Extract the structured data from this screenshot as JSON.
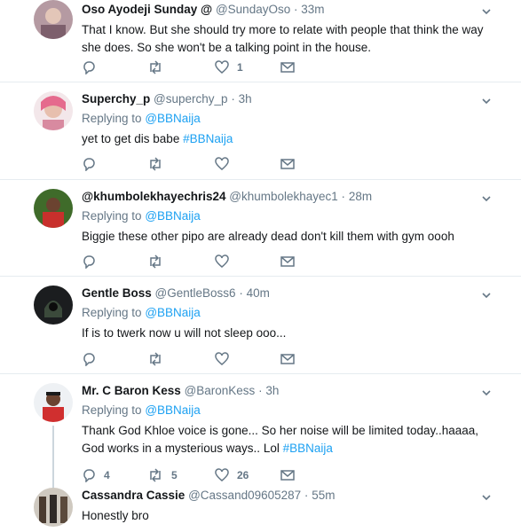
{
  "tweets": [
    {
      "name": "Oso Ayodeji Sunday @",
      "handle": "@SundayOso",
      "time": "33m",
      "replying_label": "",
      "replying_to": "",
      "text": "That I know. But she should try more to relate with people that think the way she does. So she won't be a talking point in the house.",
      "text_hashtag": "",
      "reply_count": "",
      "retweet_count": "",
      "like_count": "1"
    },
    {
      "name": "Superchy_p",
      "handle": "@superchy_p",
      "time": "3h",
      "replying_label": "Replying to",
      "replying_to": "@BBNaija",
      "text": "yet to get dis babe",
      "text_hashtag": "#BBNaija",
      "reply_count": "",
      "retweet_count": "",
      "like_count": ""
    },
    {
      "name": "@khumbolekhayechris24",
      "handle": "@khumbolekhayec1",
      "time": "28m",
      "replying_label": "Replying to",
      "replying_to": "@BBNaija",
      "text": "Biggie these other pipo are already dead don't kill them with gym oooh",
      "text_hashtag": "",
      "reply_count": "",
      "retweet_count": "",
      "like_count": ""
    },
    {
      "name": "Gentle Boss",
      "handle": "@GentleBoss6",
      "time": "40m",
      "replying_label": "Replying to",
      "replying_to": "@BBNaija",
      "text": "If is to twerk now u will not sleep ooo...",
      "text_hashtag": "",
      "reply_count": "",
      "retweet_count": "",
      "like_count": ""
    },
    {
      "name": "Mr. C Baron Kess",
      "handle": "@BaronKess",
      "time": "3h",
      "replying_label": "Replying to",
      "replying_to": "@BBNaija",
      "text": "Thank God Khloe voice is gone... So her noise will be limited today..haaaa, God works in a mysterious ways.. Lol",
      "text_hashtag": "#BBNaija",
      "reply_count": "4",
      "retweet_count": "5",
      "like_count": "26"
    },
    {
      "name": "Cassandra Cassie",
      "handle": "@Cassand09605287",
      "time": "55m",
      "replying_label": "",
      "replying_to": "",
      "text": "Honestly bro",
      "text_hashtag": "",
      "reply_count": "",
      "retweet_count": "",
      "like_count": ""
    }
  ],
  "separator": "·",
  "colors": {
    "link": "#1da1f2",
    "muted": "#657786",
    "border": "#e6ecf0"
  }
}
